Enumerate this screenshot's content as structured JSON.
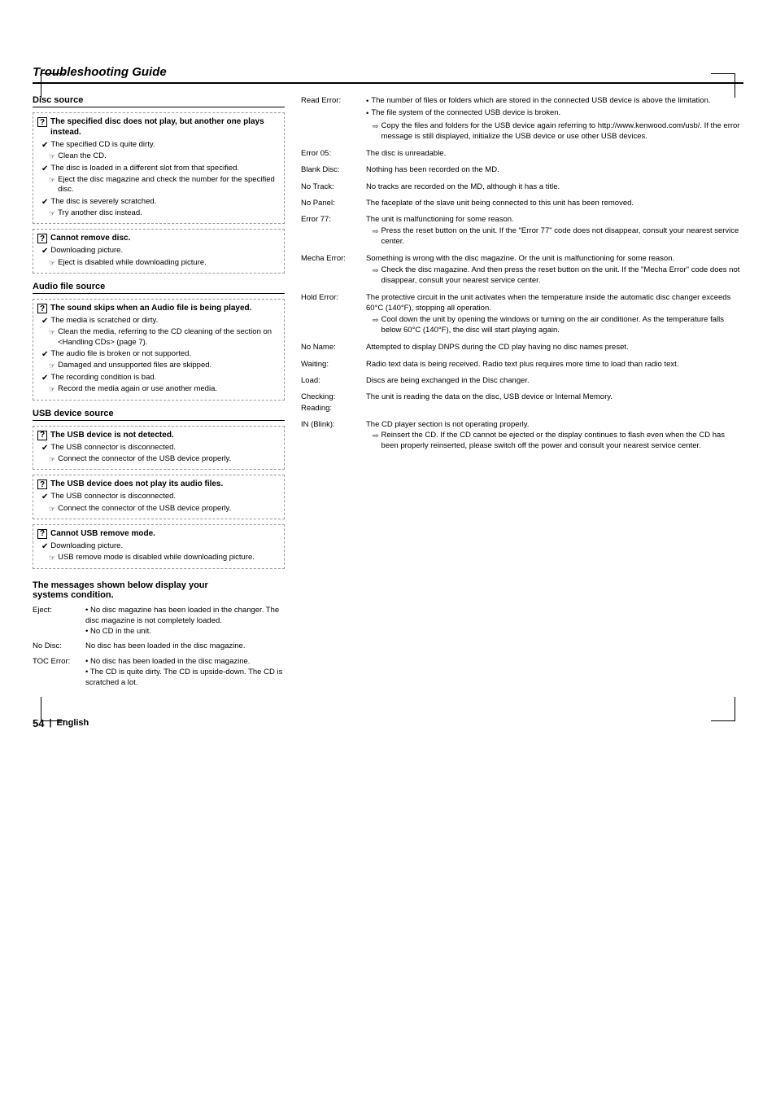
{
  "page": {
    "title": "Troubleshooting Guide",
    "footer_page": "54",
    "footer_lang": "English"
  },
  "left": {
    "sections": [
      {
        "id": "disc-source",
        "title": "Disc source",
        "problems": [
          {
            "id": "prob1",
            "icon": "?",
            "title": "The specified disc does not play, but another one plays instead.",
            "causes": [
              {
                "text": "The specified CD is quite dirty.",
                "remedy": "Clean the CD."
              },
              {
                "text": "The disc is loaded in a different slot from that specified.",
                "remedy": "Eject the disc magazine and check the number for the specified disc."
              },
              {
                "text": "The disc is severely scratched.",
                "remedy": "Try another disc instead."
              }
            ]
          },
          {
            "id": "prob2",
            "icon": "?",
            "title": "Cannot remove disc.",
            "causes": [
              {
                "text": "Downloading picture.",
                "remedy": "Eject is disabled while downloading picture."
              }
            ]
          }
        ]
      },
      {
        "id": "audio-file-source",
        "title": "Audio file source",
        "problems": [
          {
            "id": "prob3",
            "icon": "?",
            "title": "The sound skips when an Audio file is being played.",
            "causes": [
              {
                "text": "The media is scratched or dirty.",
                "remedy": "Clean the media, referring to the CD cleaning of the section on <Handling CDs> (page 7)."
              },
              {
                "text": "The audio file is broken or not supported.",
                "remedy": "Damaged and unsupported files are skipped."
              },
              {
                "text": "The recording condition is bad.",
                "remedy": "Record the media again or use another media."
              }
            ]
          }
        ]
      },
      {
        "id": "usb-device-source",
        "title": "USB device source",
        "problems": [
          {
            "id": "prob4",
            "icon": "?",
            "title": "The USB device is not detected.",
            "causes": [
              {
                "text": "The USB connector is disconnected.",
                "remedy": "Connect the connector of the USB device properly."
              }
            ]
          },
          {
            "id": "prob5",
            "icon": "?",
            "title": "The USB device does not play its audio files.",
            "causes": [
              {
                "text": "The USB connector is disconnected.",
                "remedy": "Connect the connector of the USB device properly."
              }
            ]
          },
          {
            "id": "prob6",
            "icon": "?",
            "title": "Cannot USB remove mode.",
            "causes": [
              {
                "text": "Downloading picture.",
                "remedy": "USB remove mode is disabled while downloading picture."
              }
            ]
          }
        ]
      }
    ],
    "messages": {
      "intro": "The messages shown below display your systems condition.",
      "items": [
        {
          "label": "Eject:",
          "desc": "• No disc magazine has been loaded in the changer. The disc magazine is not completely loaded.\n• No CD in the unit."
        },
        {
          "label": "No Disc:",
          "desc": "No disc has been loaded in the disc magazine."
        },
        {
          "label": "TOC Error:",
          "desc": "• No disc has been loaded in the disc magazine.\n• The CD is quite dirty. The CD is upside-down. The CD is scratched a lot."
        }
      ]
    }
  },
  "right": {
    "errors": [
      {
        "label": "Read Error:",
        "desc_bullets": [
          "The number of files or folders which are stored in the connected USB device is above the limitation.",
          "The file system of the connected USB device is broken."
        ],
        "desc_arrows": [
          "Copy the files and folders for the USB device again referring to http://www.kenwood.com/usb/. If the error message is still displayed, initialize the USB device or use other USB devices."
        ]
      },
      {
        "label": "Error 05:",
        "desc": "The disc is unreadable."
      },
      {
        "label": "Blank Disc:",
        "desc": "Nothing has been recorded on the MD."
      },
      {
        "label": "No Track:",
        "desc": "No tracks are recorded on the MD, although it has a title."
      },
      {
        "label": "No Panel:",
        "desc": "The faceplate of the slave unit being connected to this unit has been removed."
      },
      {
        "label": "Error 77:",
        "desc_bullets": [
          "The unit is malfunctioning for some reason."
        ],
        "desc_arrows": [
          "Press the reset button on the unit. If the \"Error 77\" code does not disappear, consult your nearest service center."
        ]
      },
      {
        "label": "Mecha Error:",
        "desc_text": "Something is wrong with the disc magazine. Or the unit is malfunctioning for some reason.",
        "desc_arrows": [
          "Check the disc magazine. And then press the reset button on the unit. If the \"Mecha Error\" code does not disappear, consult your nearest service center."
        ]
      },
      {
        "label": "Hold Error:",
        "desc_text": "The protective circuit in the unit activates when the temperature inside the automatic disc changer exceeds 60°C (140°F), stopping all operation.",
        "desc_arrows": [
          "Cool down the unit by opening the windows or turning on the air conditioner. As the temperature falls below 60°C (140°F), the disc will start playing again."
        ]
      },
      {
        "label": "No Name:",
        "desc": "Attempted to display DNPS during the CD play having no disc names preset."
      },
      {
        "label": "Waiting:",
        "desc": "Radio text data is being received. Radio text plus requires more time to load than radio text."
      },
      {
        "label": "Load:",
        "desc": "Discs are being exchanged in the Disc changer."
      },
      {
        "label": "Checking:\nReading:",
        "desc": "The unit is reading the data on the disc, USB device or Internal Memory."
      },
      {
        "label": "IN (Blink):",
        "desc_text": "The CD player section is not operating properly.",
        "desc_arrows": [
          "Reinsert the CD. If the CD cannot be ejected or the display continues to flash even when the CD has been properly reinserted, please switch off the power and consult your nearest service center."
        ]
      }
    ]
  }
}
